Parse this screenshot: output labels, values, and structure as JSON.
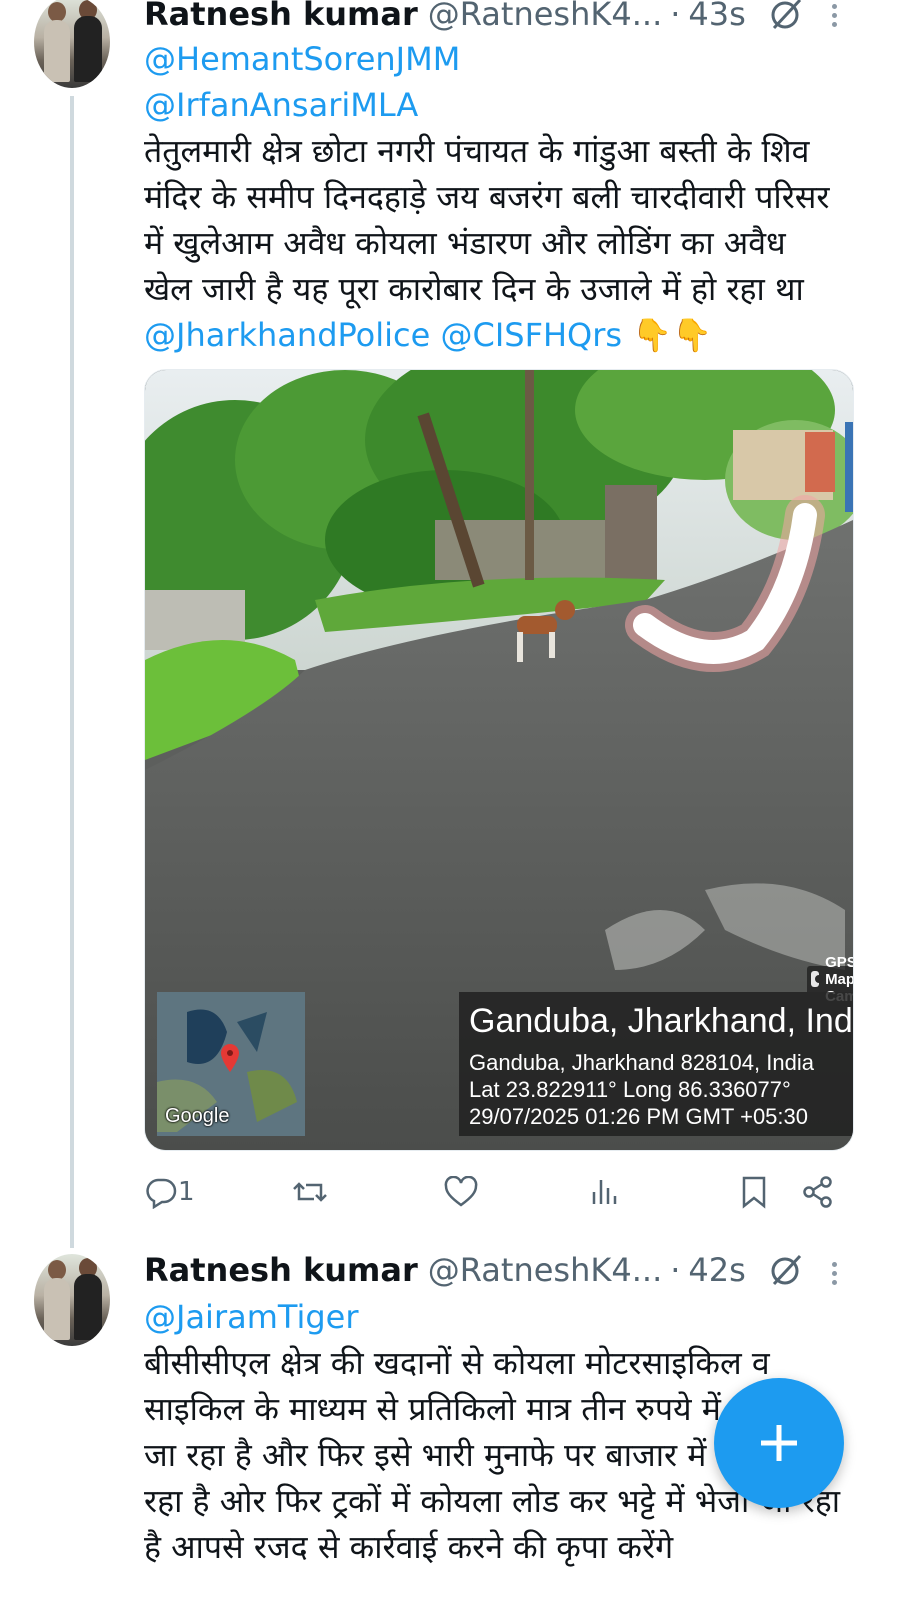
{
  "tweets": [
    {
      "author_name": "Ratnesh kumar",
      "author_handle": "@RatneshK4...",
      "time": "43s",
      "mentions": [
        "@HemantSorenJMM",
        "@IrfanAnsariMLA"
      ],
      "text_lines": [
        "तेतुलमारी क्षेत्र छोटा नगरी पंचायत के गांडुआ बस्ती के शिव",
        "मंदिर के समीप दिनदहाड़े जय बजरंग बली चारदीवारी परिसर",
        "में खुलेआम अवैध कोयला भंडारण और लोडिंग का अवैध",
        "खेल जारी है यह पूरा कारोबार दिन के उजाले में हो रहा था"
      ],
      "trailing_mentions": "@JharkhandPolice @CISFHQrs",
      "trailing_emoji": "👇👇",
      "media": {
        "badge": "GPS Map Camera",
        "map_label": "Google",
        "place": "Ganduba, Jharkhand, India",
        "address": "Ganduba, Jharkhand 828104, India",
        "coords": "Lat 23.822911° Long 86.336077°",
        "datetime": "29/07/2025 01:26 PM GMT +05:30"
      },
      "actions": {
        "reply_count": "1",
        "icons": [
          "reply-icon",
          "retweet-icon",
          "like-icon",
          "views-icon",
          "bookmark-icon",
          "share-icon"
        ]
      }
    },
    {
      "author_name": "Ratnesh kumar",
      "author_handle": "@RatneshK4...",
      "time": "42s",
      "mentions": [
        "@JairamTiger"
      ],
      "text_lines": [
        "बीसीसीएल क्षेत्र की खदानों से कोयला मोटरसाइकिल व",
        "साइकिल के माध्यम से प्रतिकिलो मात्र तीन रुपये में",
        "जा रहा है और फिर इसे भारी मुनाफे पर बाजार में",
        "रहा है ओर फिर ट्रकों में कोयला लोड कर भट्टे में भेजा जा रहा",
        "है आपसे रजद से कार्रवाई करने की कृपा करेंगे"
      ]
    }
  ],
  "colors": {
    "accent": "#1d9bf0",
    "text": "#0f1419",
    "muted": "#536471"
  },
  "fab_icon": "plus-icon"
}
